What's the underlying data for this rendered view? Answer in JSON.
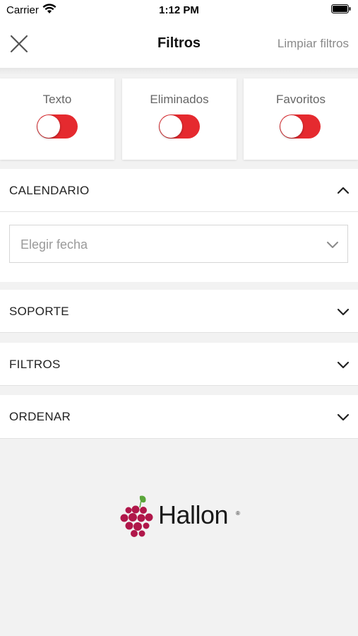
{
  "status_bar": {
    "carrier": "Carrier",
    "time": "1:12 PM",
    "icons": [
      "wifi-icon",
      "battery-icon"
    ]
  },
  "nav": {
    "title": "Filtros",
    "close_icon": "close-icon",
    "clear_label": "Limpiar filtros"
  },
  "toggles": [
    {
      "label": "Texto",
      "on": true
    },
    {
      "label": "Eliminados",
      "on": true
    },
    {
      "label": "Favoritos",
      "on": true
    }
  ],
  "sections": {
    "calendario": {
      "label": "CALENDARIO",
      "expanded": true,
      "icon": "chevron-up-icon"
    },
    "soporte": {
      "label": "SOPORTE",
      "expanded": false,
      "icon": "chevron-down-icon"
    },
    "filtros": {
      "label": "FILTROS",
      "expanded": false,
      "icon": "chevron-down-icon"
    },
    "ordenar": {
      "label": "ORDENAR",
      "expanded": false,
      "icon": "chevron-down-icon"
    }
  },
  "date_picker": {
    "placeholder": "Elegir fecha",
    "icon": "chevron-down-icon"
  },
  "logo": {
    "text": "Hallon",
    "registered_mark": "®"
  },
  "colors": {
    "accent": "#e52a2f",
    "grape": "#b0174a",
    "leaf": "#5aa63a",
    "background": "#f2f2f2"
  }
}
